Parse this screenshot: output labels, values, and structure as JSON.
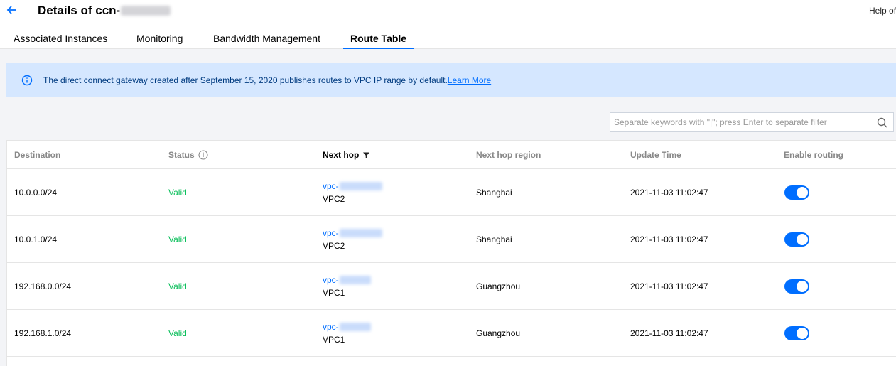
{
  "header": {
    "title_prefix": "Details of ccn-",
    "help_label": "Help of"
  },
  "tabs": [
    {
      "label": "Associated Instances",
      "active": false
    },
    {
      "label": "Monitoring",
      "active": false
    },
    {
      "label": "Bandwidth Management",
      "active": false
    },
    {
      "label": "Route Table",
      "active": true
    }
  ],
  "notice": {
    "text": "The direct connect gateway created after September 15, 2020 publishes routes to VPC IP range by default.",
    "link": "Learn More"
  },
  "search": {
    "placeholder": "Separate keywords with \"|\"; press Enter to separate filter"
  },
  "table": {
    "columns": [
      "Destination",
      "Status",
      "Next hop",
      "Next hop region",
      "Update Time",
      "Enable routing"
    ],
    "rows": [
      {
        "destination": "10.0.0.0/24",
        "status": "Valid",
        "next_hop_id": "vpc-",
        "next_hop_name": "VPC2",
        "region": "Shanghai",
        "update_time": "2021-11-03 11:02:47",
        "enabled": true
      },
      {
        "destination": "10.0.1.0/24",
        "status": "Valid",
        "next_hop_id": "vpc-",
        "next_hop_name": "VPC2",
        "region": "Shanghai",
        "update_time": "2021-11-03 11:02:47",
        "enabled": true
      },
      {
        "destination": "192.168.0.0/24",
        "status": "Valid",
        "next_hop_id": "vpc-",
        "next_hop_name": "VPC1",
        "region": "Guangzhou",
        "update_time": "2021-11-03 11:02:47",
        "enabled": true
      },
      {
        "destination": "192.168.1.0/24",
        "status": "Valid",
        "next_hop_id": "vpc-",
        "next_hop_name": "VPC1",
        "region": "Guangzhou",
        "update_time": "2021-11-03 11:02:47",
        "enabled": true
      }
    ]
  },
  "colors": {
    "accent": "#006eff",
    "valid": "#0abf5b",
    "notice_bg": "#d5e7ff"
  },
  "icons": {
    "back": "arrow-left-icon",
    "info": "info-circle-icon",
    "search": "search-icon",
    "status_help": "info-circle-icon",
    "filter": "filter-icon"
  }
}
